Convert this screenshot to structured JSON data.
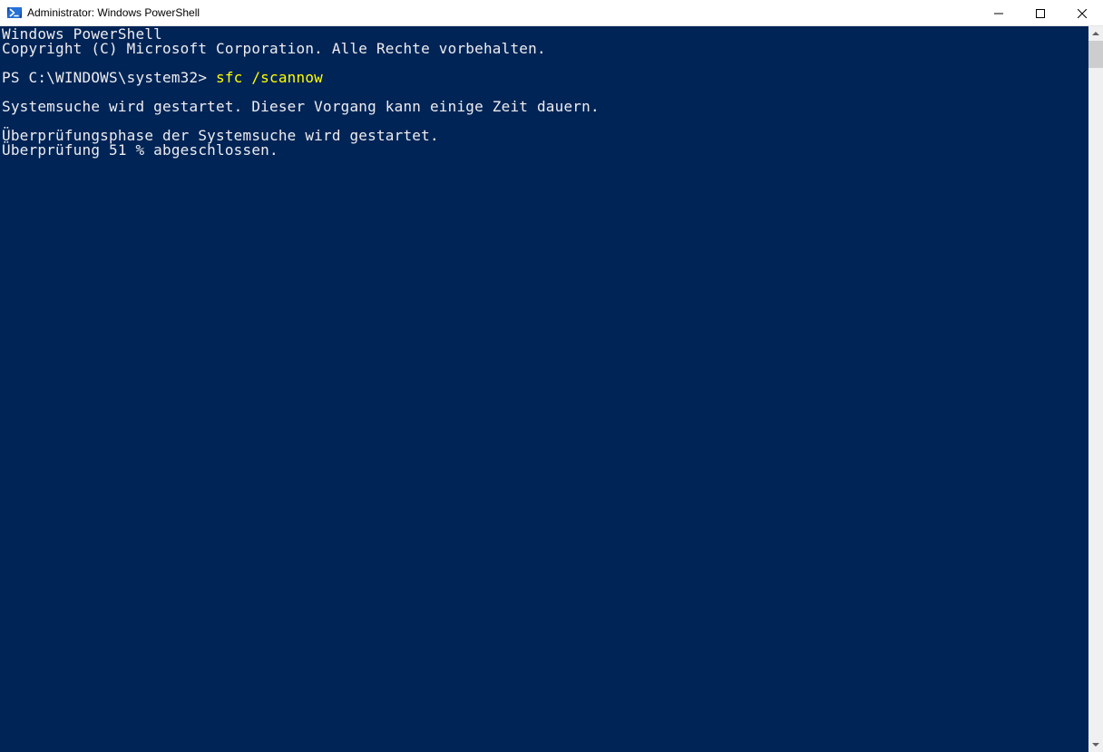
{
  "window": {
    "title": "Administrator: Windows PowerShell"
  },
  "console": {
    "header_line1": "Windows PowerShell",
    "header_line2": "Copyright (C) Microsoft Corporation. Alle Rechte vorbehalten.",
    "prompt": "PS C:\\WINDOWS\\system32>",
    "command": "sfc /scannow",
    "output_line1": "Systemsuche wird gestartet. Dieser Vorgang kann einige Zeit dauern.",
    "output_line2": "Überprüfungsphase der Systemsuche wird gestartet.",
    "output_line3": "Überprüfung 51 % abgeschlossen."
  },
  "colors": {
    "console_bg": "#012456",
    "console_fg": "#eeedf0",
    "command_fg": "#ffff00"
  }
}
